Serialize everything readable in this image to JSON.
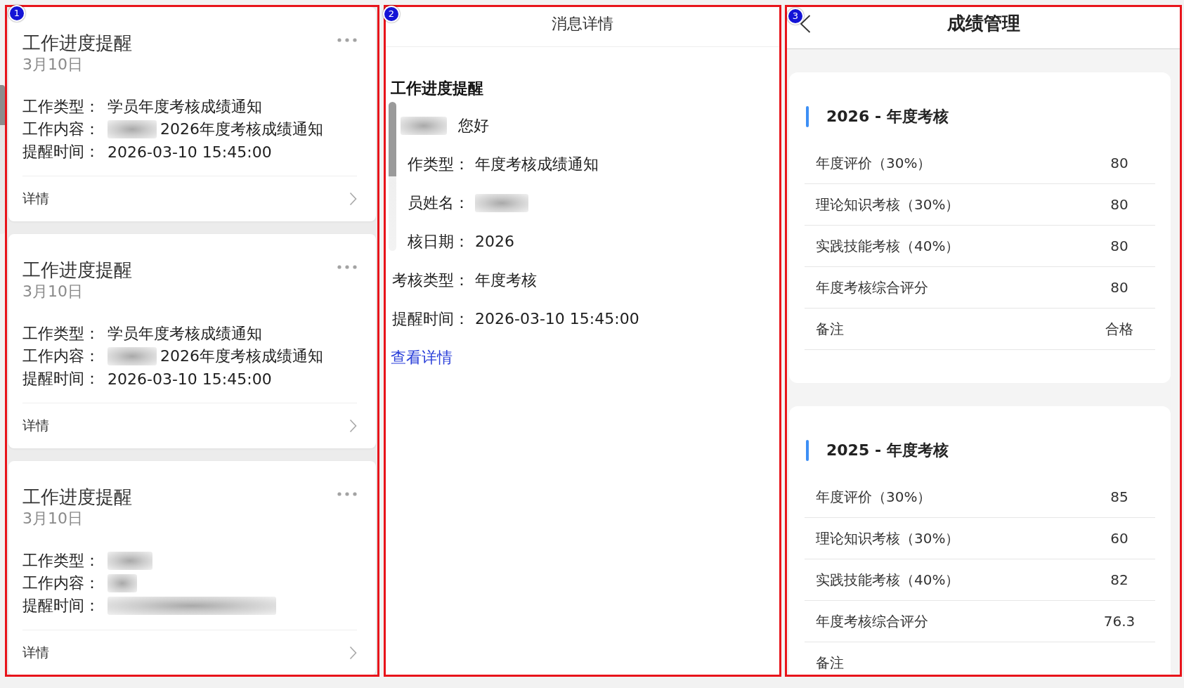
{
  "message_list": {
    "badge": "1",
    "cards": [
      {
        "title": "工作进度提醒",
        "date": "3月10日",
        "fields": [
          {
            "label": "工作类型：",
            "value": "学员年度考核成绩通知",
            "redacted": false
          },
          {
            "label": "工作内容：",
            "value": "2026年度考核成绩通知",
            "redacted": true
          },
          {
            "label": "提醒时间：",
            "value": "2026-03-10 15:45:00",
            "redacted": false
          }
        ],
        "link": "详情"
      },
      {
        "title": "工作进度提醒",
        "date": "3月10日",
        "fields": [
          {
            "label": "工作类型：",
            "value": "学员年度考核成绩通知",
            "redacted": false
          },
          {
            "label": "工作内容：",
            "value": "2026年度考核成绩通知",
            "redacted": true
          },
          {
            "label": "提醒时间：",
            "value": "2026-03-10 15:45:00",
            "redacted": false
          }
        ],
        "link": "详情"
      },
      {
        "title": "工作进度提醒",
        "date": "3月10日",
        "fields": [
          {
            "label": "工作类型：",
            "redacted": true
          },
          {
            "label": "工作内容：",
            "redacted": true
          },
          {
            "label": "提醒时间：",
            "redacted": true
          }
        ],
        "link": "详情"
      }
    ]
  },
  "message_detail": {
    "badge": "2",
    "title": "消息详情",
    "heading": "工作进度提醒",
    "greeting": {
      "redacted": true,
      "text": "您好"
    },
    "fields": [
      {
        "label": "作类型：",
        "value": "年度考核成绩通知",
        "redacted": false
      },
      {
        "label": "员姓名：",
        "redacted": true
      },
      {
        "label": "核日期：",
        "value": "2026",
        "redacted": false
      },
      {
        "label": "考核类型：",
        "value": "年度考核",
        "redacted": false
      },
      {
        "label": "提醒时间：",
        "value": "2026-03-10 15:45:00",
        "redacted": false
      }
    ],
    "link": "查看详情"
  },
  "score_management": {
    "badge": "3",
    "title": "成绩管理",
    "sections": [
      {
        "title": "2026 - 年度考核",
        "rows": [
          {
            "label": "年度评价（30%）",
            "value": "80"
          },
          {
            "label": "理论知识考核（30%）",
            "value": "80"
          },
          {
            "label": "实践技能考核（40%）",
            "value": "80"
          },
          {
            "label": "年度考核综合评分",
            "value": "80"
          },
          {
            "label": "备注",
            "value": "合格"
          }
        ]
      },
      {
        "title": "2025 - 年度考核",
        "rows": [
          {
            "label": "年度评价（30%）",
            "value": "85"
          },
          {
            "label": "理论知识考核（30%）",
            "value": "60"
          },
          {
            "label": "实践技能考核（40%）",
            "value": "82"
          },
          {
            "label": "年度考核综合评分",
            "value": "76.3"
          },
          {
            "label": "备注"
          }
        ]
      }
    ]
  }
}
